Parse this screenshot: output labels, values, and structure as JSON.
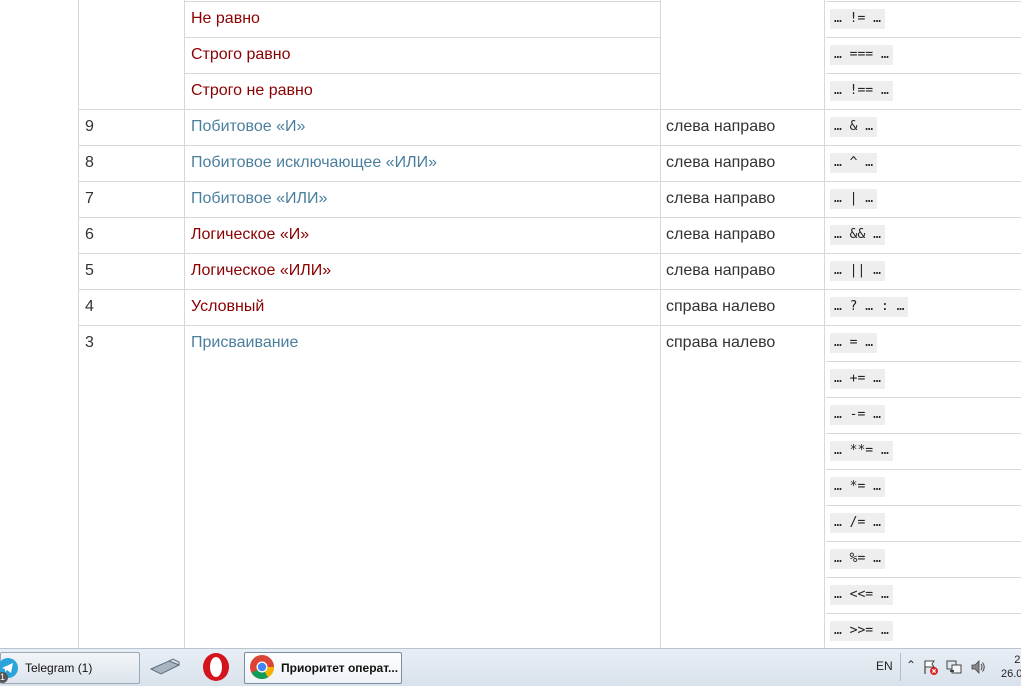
{
  "table": {
    "rows_partial": [
      {
        "name": "Не равно",
        "code": "… != …"
      },
      {
        "name": "Строго равно",
        "code": "… === …"
      },
      {
        "name": "Строго не равно",
        "code": "… !== …"
      }
    ],
    "rows": [
      {
        "priority": "9",
        "name": "Побитовое «И»",
        "assoc": "слева направо",
        "code": "… & …"
      },
      {
        "priority": "8",
        "name": "Побитовое исключающее «ИЛИ»",
        "assoc": "слева направо",
        "code": "… ^ …"
      },
      {
        "priority": "7",
        "name": "Побитовое «ИЛИ»",
        "assoc": "слева направо",
        "code": "… | …"
      },
      {
        "priority": "6",
        "name": "Логическое «И»",
        "assoc": "слева направо",
        "code": "… && …"
      },
      {
        "priority": "5",
        "name": "Логическое «ИЛИ»",
        "assoc": "слева направо",
        "code": "… || …"
      },
      {
        "priority": "4",
        "name": "Условный",
        "assoc": "справа налево",
        "code": "… ? … : …"
      }
    ],
    "assignment": {
      "priority": "3",
      "name": "Присваивание",
      "assoc": "справа налево",
      "codes": [
        "… = …",
        "… += …",
        "… -= …",
        "… **= …",
        "… *= …",
        "… /= …",
        "… %= …",
        "… <<= …",
        "… >>= …"
      ]
    }
  },
  "taskbar": {
    "telegram_label": "Telegram (1)",
    "telegram_badge": "1",
    "chrome_label": "Приоритет операт...",
    "lang": "EN",
    "clock_time": "2",
    "clock_date": "26.0"
  }
}
